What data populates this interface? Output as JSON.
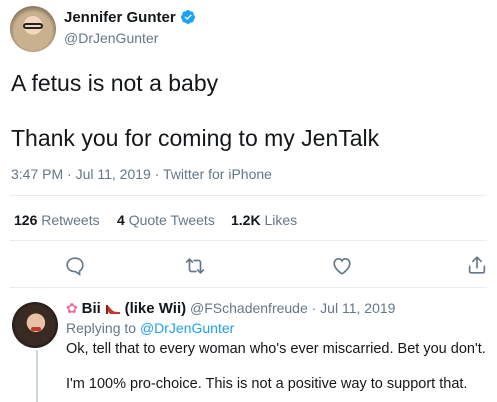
{
  "tweet": {
    "author_name": "Jennifer Gunter",
    "author_handle": "@DrJenGunter",
    "line1": "A fetus is not a baby",
    "line2": "Thank you for coming to my JenTalk",
    "meta": "3:47 PM · Jul 11, 2019 · Twitter for iPhone",
    "stats": {
      "retweets_count": "126",
      "retweets_label": "Retweets",
      "quotes_count": "4",
      "quotes_label": "Quote Tweets",
      "likes_count": "1.2K",
      "likes_label": "Likes"
    }
  },
  "actions": {
    "reply_icon": "speech-bubble-icon",
    "retweet_icon": "retweet-icon",
    "like_icon": "heart-icon",
    "share_icon": "share-icon"
  },
  "reply": {
    "name": "Bii",
    "name_suffix": "(like Wii)",
    "handle_date": "@FSchadenfreude · Jul 11, 2019",
    "replying_prefix": "Replying to",
    "replying_to": "@DrJenGunter",
    "text1": "Ok, tell that to every woman who's ever miscarried. Bet you don't.",
    "text2": "I'm 100% pro-choice. This is not a positive way to support that."
  },
  "colors": {
    "accent": "#1da1f2",
    "muted": "#657786",
    "divider": "#e6ecf0"
  }
}
